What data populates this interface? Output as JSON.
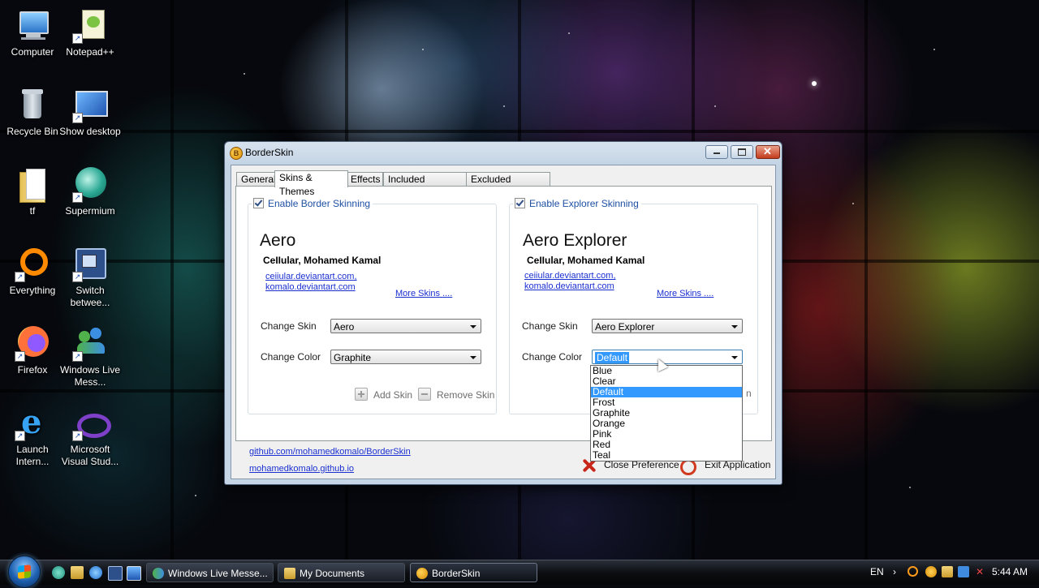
{
  "desktop": {
    "icons": [
      {
        "label": "Computer"
      },
      {
        "label": "Notepad++"
      },
      {
        "label": "Recycle Bin"
      },
      {
        "label": "Show desktop"
      },
      {
        "label": "tf"
      },
      {
        "label": "Supermium"
      },
      {
        "label": "Everything"
      },
      {
        "label": "Switch betwee..."
      },
      {
        "label": "Firefox"
      },
      {
        "label": "Windows Live Mess..."
      },
      {
        "label": "Launch Intern..."
      },
      {
        "label": "Microsoft Visual Stud..."
      }
    ]
  },
  "window": {
    "title": "BorderSkin",
    "tabs": [
      {
        "label": "General"
      },
      {
        "label": "Skins & Themes"
      },
      {
        "label": "Effects"
      },
      {
        "label": "Included Windows"
      },
      {
        "label": "Excluded Windows"
      }
    ],
    "border_group": {
      "legend": "Enable Border Skinning",
      "skin_name": "Aero",
      "author": "CeIIular, Mohamed Kamal",
      "link1": "ceiiular.deviantart.com,",
      "link2": "komalo.deviantart.com",
      "more_skins": "More Skins ....",
      "change_skin_label": "Change Skin",
      "change_skin_value": "Aero",
      "change_color_label": "Change Color",
      "change_color_value": "Graphite",
      "add_skin": "Add Skin",
      "remove_skin": "Remove Skin"
    },
    "explorer_group": {
      "legend": "Enable Explorer Skinning",
      "skin_name": "Aero Explorer",
      "author": "CeIIular, Mohamed Kamal",
      "link1": "ceiiular.deviantart.com,",
      "link2": "komalo.deviantart.com",
      "more_skins": "More Skins ....",
      "change_skin_label": "Change Skin",
      "change_skin_value": "Aero Explorer",
      "change_color_label": "Change Color",
      "change_color_value": "Default",
      "color_options": [
        "Blue",
        "Clear",
        "Default",
        "Frost",
        "Graphite",
        "Orange",
        "Pink",
        "Red",
        "Teal"
      ],
      "selected_option": "Default",
      "hidden_tail": "n"
    },
    "footer": {
      "github_link": "github.com/mohamedkomalo/BorderSkin",
      "site_link": "mohamedkomalo.github.io",
      "close_preference": "Close Preference",
      "exit_application": "Exit Application"
    }
  },
  "taskbar": {
    "buttons": [
      {
        "label": "Windows Live Messe..."
      },
      {
        "label": "My Documents"
      },
      {
        "label": "BorderSkin"
      }
    ],
    "language": "EN",
    "clock": "5:44 AM"
  },
  "colors": {
    "accent_link": "#1a2fd0",
    "legend_text": "#1e4fa3",
    "selection": "#3399ff",
    "close_red": "#c8261a"
  }
}
